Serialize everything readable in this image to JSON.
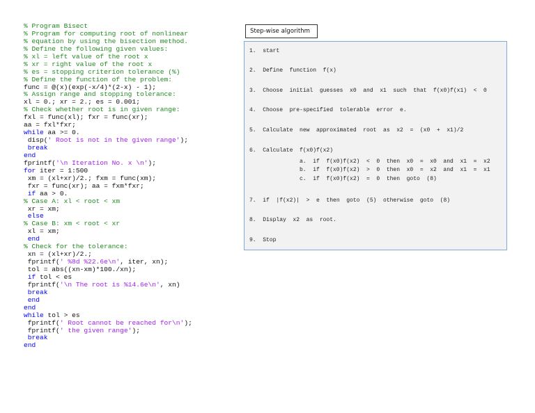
{
  "code": [
    [
      [
        "comment",
        "% Program Bisect"
      ]
    ],
    [
      [
        "comment",
        "% Program for computing root of nonlinear"
      ]
    ],
    [
      [
        "comment",
        "% equation by using the bisection method."
      ]
    ],
    [
      [
        "comment",
        "% Define the following given values:"
      ]
    ],
    [
      [
        "comment",
        "% xl = left value of the root x"
      ]
    ],
    [
      [
        "comment",
        "% xr = right value of the root x"
      ]
    ],
    [
      [
        "comment",
        "% es = stopping criterion tolerance (%)"
      ]
    ],
    [
      [
        "comment",
        "% Define the function of the problem:"
      ]
    ],
    [
      [
        "plain",
        "func = @(x)(exp(-x/4)*(2-x) - 1);"
      ]
    ],
    [
      [
        "comment",
        "% Assign range and stopping tolerance:"
      ]
    ],
    [
      [
        "plain",
        "xl = 0.; xr = 2.; es = 0.001;"
      ]
    ],
    [
      [
        "comment",
        "% Check whether root is in given range:"
      ]
    ],
    [
      [
        "plain",
        "fxl = func(xl); fxr = func(xr);"
      ]
    ],
    [
      [
        "plain",
        "aa = fxl*fxr;"
      ]
    ],
    [
      [
        "keyword",
        "while"
      ],
      [
        "plain",
        " aa >= 0."
      ]
    ],
    [
      [
        "plain",
        " disp("
      ],
      [
        "string",
        "' Root is not in the given range'"
      ],
      [
        "plain",
        ");"
      ]
    ],
    [
      [
        "keyword",
        " break"
      ]
    ],
    [
      [
        "keyword",
        "end"
      ]
    ],
    [
      [
        "plain",
        "fprintf("
      ],
      [
        "string",
        "'\\n Iteration No. x \\n'"
      ],
      [
        "plain",
        ");"
      ]
    ],
    [
      [
        "keyword",
        "for"
      ],
      [
        "plain",
        " iter = 1:500"
      ]
    ],
    [
      [
        "plain",
        " xm = (xl+xr)/2.; fxm = func(xm);"
      ]
    ],
    [
      [
        "plain",
        " fxr = func(xr); aa = fxm*fxr;"
      ]
    ],
    [
      [
        "keyword",
        " if"
      ],
      [
        "plain",
        " aa > 0."
      ]
    ],
    [
      [
        "comment",
        "% Case A: xl < root < xm"
      ]
    ],
    [
      [
        "plain",
        " xr = xm;"
      ]
    ],
    [
      [
        "keyword",
        " else"
      ]
    ],
    [
      [
        "comment",
        "% Case B: xm < root < xr"
      ]
    ],
    [
      [
        "plain",
        " xl = xm;"
      ]
    ],
    [
      [
        "keyword",
        " end"
      ]
    ],
    [
      [
        "comment",
        "% Check for the tolerance:"
      ]
    ],
    [
      [
        "plain",
        " xn = (xl+xr)/2.;"
      ]
    ],
    [
      [
        "plain",
        " fprintf("
      ],
      [
        "string",
        "' %8d %22.6e\\n'"
      ],
      [
        "plain",
        ", iter, xn);"
      ]
    ],
    [
      [
        "plain",
        " tol = abs((xn-xm)*100./xn);"
      ]
    ],
    [
      [
        "keyword",
        " if"
      ],
      [
        "plain",
        " tol < es"
      ]
    ],
    [
      [
        "plain",
        " fprintf("
      ],
      [
        "string",
        "'\\n The root is %14.6e\\n'"
      ],
      [
        "plain",
        ", xn)"
      ]
    ],
    [
      [
        "keyword",
        " break"
      ]
    ],
    [
      [
        "keyword",
        " end"
      ]
    ],
    [
      [
        "keyword",
        "end"
      ]
    ],
    [
      [
        "keyword",
        "while"
      ],
      [
        "plain",
        " tol > es"
      ]
    ],
    [
      [
        "plain",
        " fprintf("
      ],
      [
        "string",
        "' Root cannot be reached for\\n'"
      ],
      [
        "plain",
        ");"
      ]
    ],
    [
      [
        "plain",
        " fprintf("
      ],
      [
        "string",
        "' the given range'"
      ],
      [
        "plain",
        ");"
      ]
    ],
    [
      [
        "keyword",
        " break"
      ]
    ],
    [
      [
        "keyword",
        "end"
      ]
    ]
  ],
  "algorithm": {
    "title": "Step-wise algorithm",
    "steps": [
      "1.  start",
      "2.  Define  function  f(x)",
      "3.  Choose  initial  guesses  x0  and  x1  such  that  f(x0)f(x1)  <  0",
      "4.  Choose  pre-specified  tolerable  error  e.",
      "5.  Calculate  new  approximated  root  as  x2  =  (x0  +  x1)/2",
      "6.  Calculate  f(x0)f(x2)",
      "7.  if  |f(x2)|  >  e  then  goto  (5)  otherwise  goto  (8)",
      "8.  Display  x2  as  root.",
      "9.  Stop"
    ],
    "substeps": [
      "a.  if  f(x0)f(x2)  <  0  then  x0  =  x0  and  x1  =  x2",
      "b.  if  f(x0)f(x2)  >  0  then  x0  =  x2  and  x1  =  x1",
      "c.  if  f(x0)f(x2)  =  0  then  goto  (8)"
    ]
  }
}
